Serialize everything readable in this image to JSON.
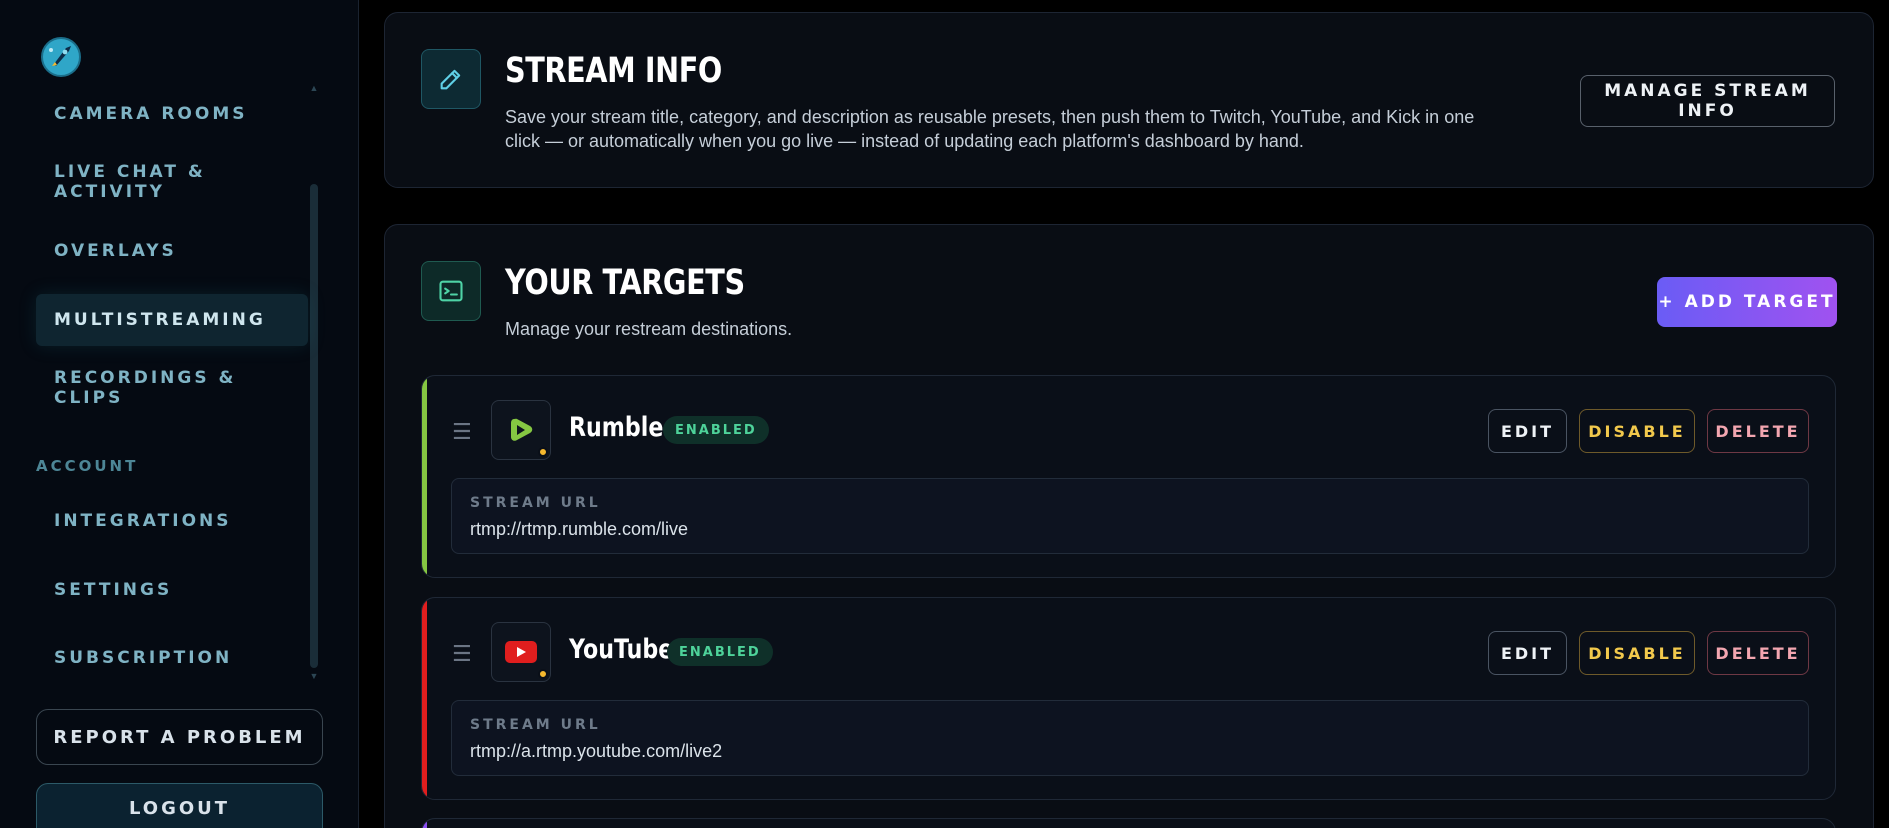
{
  "sidebar": {
    "nav": [
      {
        "label": "CAMERA ROOMS"
      },
      {
        "label": "LIVE CHAT & ACTIVITY"
      },
      {
        "label": "OVERLAYS"
      },
      {
        "label": "MULTISTREAMING",
        "active": true
      },
      {
        "label": "RECORDINGS & CLIPS"
      }
    ],
    "account_section": "ACCOUNT",
    "account_nav": [
      {
        "label": "INTEGRATIONS"
      },
      {
        "label": "SETTINGS"
      },
      {
        "label": "SUBSCRIPTION"
      }
    ],
    "report_label": "REPORT A PROBLEM",
    "logout_label": "LOGOUT"
  },
  "stream_info": {
    "title": "STREAM INFO",
    "description": "Save your stream title, category, and description as reusable presets, then push them to Twitch, YouTube, and Kick in one click — or automatically when you go live — instead of updating each platform's dashboard by hand.",
    "button_label": "MANAGE STREAM INFO"
  },
  "targets": {
    "title": "YOUR TARGETS",
    "subtitle": "Manage your restream destinations.",
    "add_label": "+ ADD TARGET",
    "items": [
      {
        "name": "Rumble",
        "status": "ENABLED",
        "url_label": "STREAM URL",
        "url": "rtmp://rtmp.rumble.com/live",
        "accent": "#85c742",
        "icon": "rumble-icon",
        "edit_label": "EDIT",
        "disable_label": "DISABLE",
        "delete_label": "DELETE"
      },
      {
        "name": "YouTube",
        "status": "ENABLED",
        "url_label": "STREAM URL",
        "url": "rtmp://a.rtmp.youtube.com/live2",
        "accent": "#e01e1e",
        "icon": "youtube-icon",
        "edit_label": "EDIT",
        "disable_label": "DISABLE",
        "delete_label": "DELETE"
      }
    ]
  },
  "colors": {
    "background": "#000000",
    "card": "#090d14",
    "accent_gradient_start": "#6a5cf5",
    "accent_gradient_end": "#a052f0",
    "enabled_badge": "#4ed39a",
    "disable_text": "#f2c94c",
    "delete_text": "#f3a6b0"
  }
}
